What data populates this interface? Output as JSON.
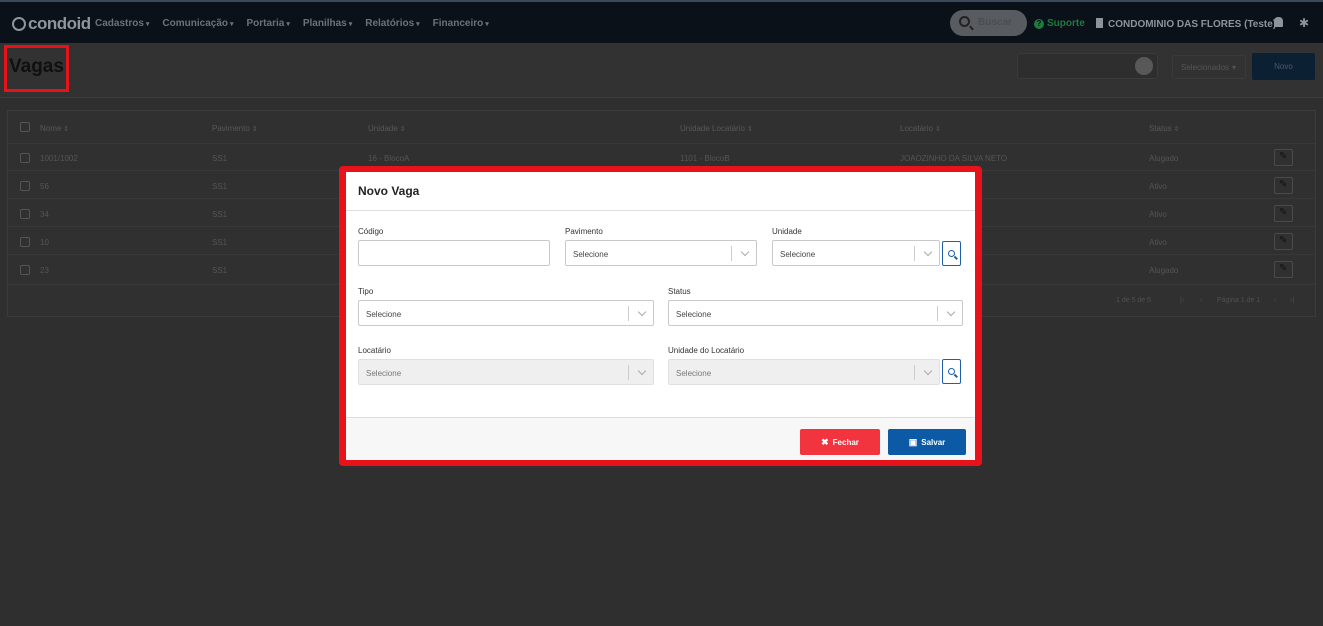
{
  "app": {
    "logo": "condoid",
    "nav": [
      "Cadastros",
      "Comunicação",
      "Portaria",
      "Planilhas",
      "Relatórios",
      "Financeiro"
    ],
    "search_label": "Buscar",
    "support_label": "Suporte",
    "condo_name": "CONDOMINIO DAS FLORES (Teste)"
  },
  "page": {
    "title": "Vagas",
    "filter_select": "Selecionados",
    "new_button": "Novo"
  },
  "table": {
    "columns": [
      "Nome",
      "Pavimento",
      "Unidade",
      "Unidade Locatário",
      "Locatário",
      "Status"
    ],
    "rows": [
      {
        "nome": "1001/1002",
        "pavimento": "SS1",
        "unidade": "16 - BlocoA",
        "unidade_locatario": "1101 - BlocoB",
        "locatario": "JOAOZINHO DA SILVA NETO",
        "status": "Alugado"
      },
      {
        "nome": "56",
        "pavimento": "SS1",
        "unidade": "",
        "unidade_locatario": "",
        "locatario": "",
        "status": "Ativo"
      },
      {
        "nome": "34",
        "pavimento": "SS1",
        "unidade": "",
        "unidade_locatario": "",
        "locatario": "",
        "status": "Ativo"
      },
      {
        "nome": "10",
        "pavimento": "SS1",
        "unidade": "",
        "unidade_locatario": "",
        "locatario": "",
        "status": "Ativo"
      },
      {
        "nome": "23",
        "pavimento": "SS1",
        "unidade": "",
        "unidade_locatario": "",
        "locatario": "",
        "status": "Alugado"
      }
    ],
    "count": "1 de 5 de 5",
    "pagination": "Página 1 de 1"
  },
  "modal": {
    "title": "Novo Vaga",
    "fields": {
      "codigo": {
        "label": "Código",
        "value": ""
      },
      "pavimento": {
        "label": "Pavimento",
        "value": "Selecione"
      },
      "unidade": {
        "label": "Unidade",
        "value": "Selecione"
      },
      "tipo": {
        "label": "Tipo",
        "value": "Selecione"
      },
      "status": {
        "label": "Status",
        "value": "Selecione"
      },
      "locatario": {
        "label": "Locatário",
        "value": "Selecione"
      },
      "unidade_locatario": {
        "label": "Unidade do Locatário",
        "value": "Selecione"
      }
    },
    "close_label": "Fechar",
    "save_label": "Salvar"
  },
  "colors": {
    "highlight": "#e8131a",
    "close_button": "#f2343e",
    "save_button": "#0c5aa6",
    "topbar": "#0b1118"
  }
}
